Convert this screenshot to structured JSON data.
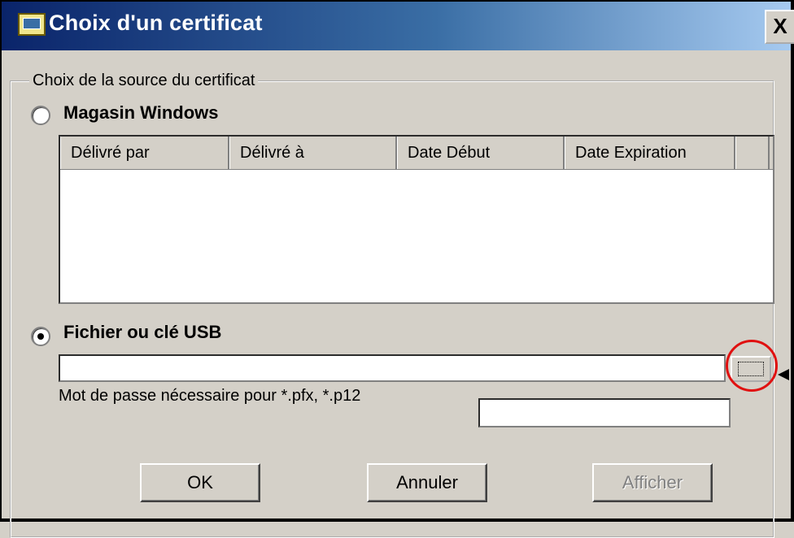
{
  "window": {
    "title": "Choix d'un certificat",
    "close_label": "X"
  },
  "source_group": {
    "legend": "Choix de la source du certificat",
    "windows_store": {
      "label": "Magasin Windows",
      "selected": false
    },
    "columns": [
      "Délivré par",
      "Délivré à",
      "Date Début",
      "Date Expiration"
    ],
    "rows": [],
    "file_usb": {
      "label": "Fichier ou clé USB",
      "selected": true,
      "path_value": ""
    },
    "password": {
      "label": "Mot de passe nécessaire pour *.pfx, *.p12",
      "value": ""
    }
  },
  "buttons": {
    "ok": "OK",
    "cancel": "Annuler",
    "show": "Afficher"
  },
  "annotation": {
    "highlight_color": "#e01010"
  }
}
